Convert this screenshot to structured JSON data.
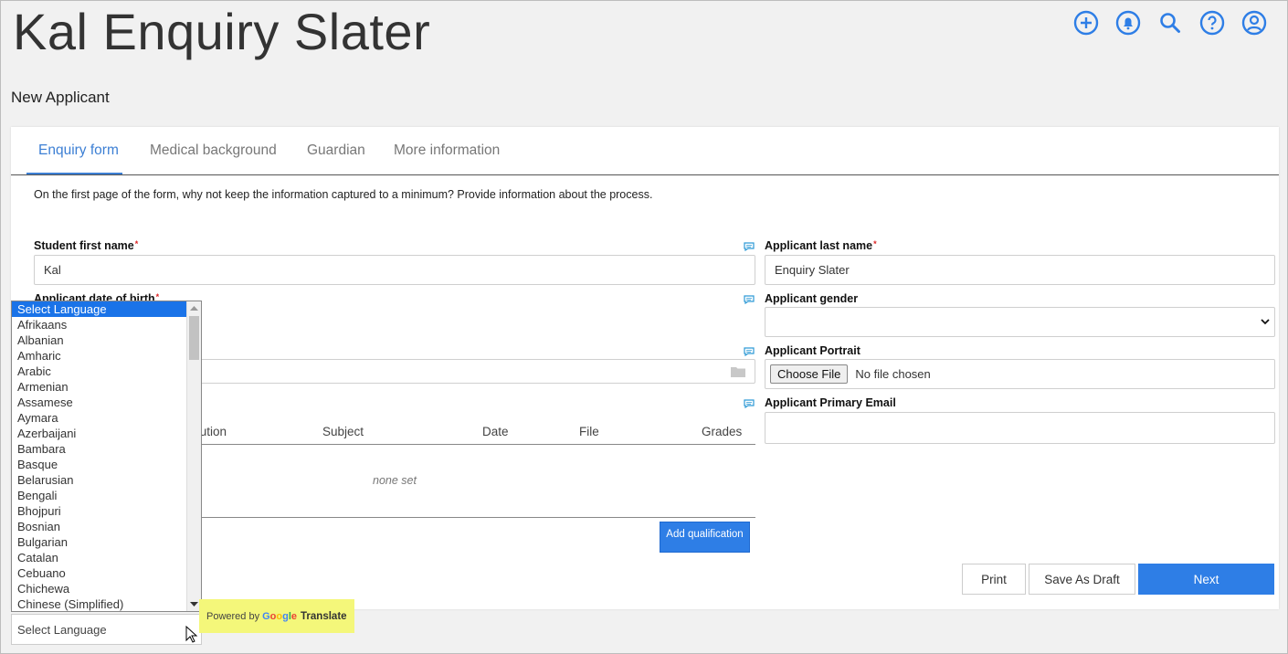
{
  "header": {
    "title": "Kal Enquiry Slater",
    "subtitle": "New Applicant",
    "icons": [
      "add-circle-icon",
      "bell-icon",
      "search-icon",
      "help-icon",
      "user-icon"
    ],
    "accent": "#2e7ee6"
  },
  "tabs": [
    {
      "label": "Enquiry form",
      "active": true
    },
    {
      "label": "Medical background"
    },
    {
      "label": "Guardian"
    },
    {
      "label": "More information"
    }
  ],
  "intro": "On the first page of the form, why not keep the information captured to a minimum? Provide information about the process.",
  "form": {
    "first_name_label": "Student first name",
    "first_name_value": "Kal",
    "last_name_label": "Applicant last name",
    "last_name_value": "Enquiry Slater",
    "dob_label": "Applicant date of birth",
    "gender_label": "Applicant gender",
    "gender_value": "",
    "portrait_label": "Applicant Portrait",
    "choose_file": "Choose File",
    "no_file": "No file chosen",
    "email_label": "Applicant Primary Email",
    "email_value": "",
    "required_mark": "*"
  },
  "qualifications": {
    "columns": [
      "itution",
      "Subject",
      "Date",
      "File",
      "Grades"
    ],
    "empty": "none set",
    "add_label": "Add qualification"
  },
  "buttons": {
    "print": "Print",
    "save_draft": "Save As Draft",
    "next": "Next"
  },
  "translate": {
    "options": [
      "Select Language",
      "Afrikaans",
      "Albanian",
      "Amharic",
      "Arabic",
      "Armenian",
      "Assamese",
      "Aymara",
      "Azerbaijani",
      "Bambara",
      "Basque",
      "Belarusian",
      "Bengali",
      "Bhojpuri",
      "Bosnian",
      "Bulgarian",
      "Catalan",
      "Cebuano",
      "Chichewa",
      "Chinese (Simplified)"
    ],
    "selected": "Select Language",
    "powered_by": "Powered by",
    "google": "Google",
    "translate": "Translate"
  }
}
